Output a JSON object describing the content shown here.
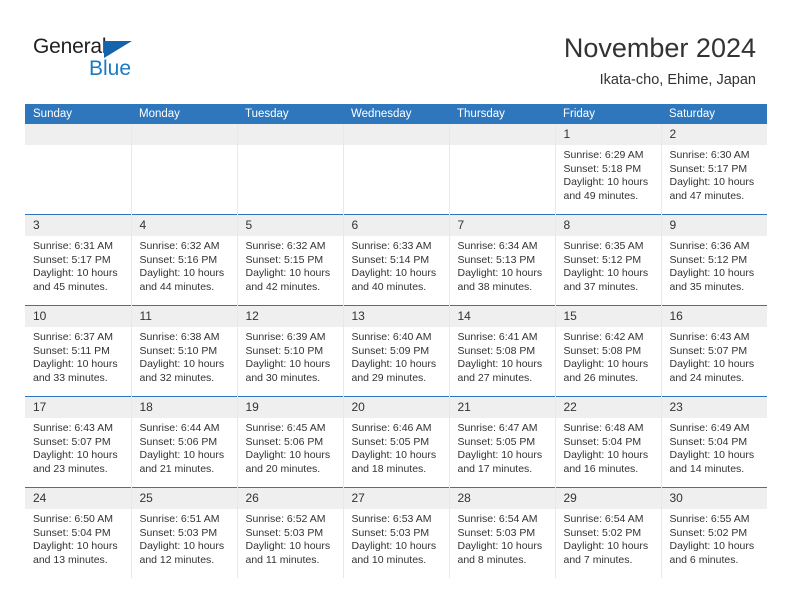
{
  "brand": {
    "name_part1": "General",
    "name_part2": "Blue",
    "triangle_icon": "blue-triangle-icon",
    "accent_color": "#1a7bc4"
  },
  "header": {
    "title": "November 2024",
    "subtitle": "Ikata-cho, Ehime, Japan",
    "header_bar_color": "#2f77bc",
    "daynum_band_color": "#efefef"
  },
  "weekdays": [
    "Sunday",
    "Monday",
    "Tuesday",
    "Wednesday",
    "Thursday",
    "Friday",
    "Saturday"
  ],
  "weeks": [
    [
      {
        "day": "",
        "sunrise": "",
        "sunset": "",
        "daylight_line1": "",
        "daylight_line2": ""
      },
      {
        "day": "",
        "sunrise": "",
        "sunset": "",
        "daylight_line1": "",
        "daylight_line2": ""
      },
      {
        "day": "",
        "sunrise": "",
        "sunset": "",
        "daylight_line1": "",
        "daylight_line2": ""
      },
      {
        "day": "",
        "sunrise": "",
        "sunset": "",
        "daylight_line1": "",
        "daylight_line2": ""
      },
      {
        "day": "",
        "sunrise": "",
        "sunset": "",
        "daylight_line1": "",
        "daylight_line2": ""
      },
      {
        "day": "1",
        "sunrise": "Sunrise: 6:29 AM",
        "sunset": "Sunset: 5:18 PM",
        "daylight_line1": "Daylight: 10 hours",
        "daylight_line2": "and 49 minutes."
      },
      {
        "day": "2",
        "sunrise": "Sunrise: 6:30 AM",
        "sunset": "Sunset: 5:17 PM",
        "daylight_line1": "Daylight: 10 hours",
        "daylight_line2": "and 47 minutes."
      }
    ],
    [
      {
        "day": "3",
        "sunrise": "Sunrise: 6:31 AM",
        "sunset": "Sunset: 5:17 PM",
        "daylight_line1": "Daylight: 10 hours",
        "daylight_line2": "and 45 minutes."
      },
      {
        "day": "4",
        "sunrise": "Sunrise: 6:32 AM",
        "sunset": "Sunset: 5:16 PM",
        "daylight_line1": "Daylight: 10 hours",
        "daylight_line2": "and 44 minutes."
      },
      {
        "day": "5",
        "sunrise": "Sunrise: 6:32 AM",
        "sunset": "Sunset: 5:15 PM",
        "daylight_line1": "Daylight: 10 hours",
        "daylight_line2": "and 42 minutes."
      },
      {
        "day": "6",
        "sunrise": "Sunrise: 6:33 AM",
        "sunset": "Sunset: 5:14 PM",
        "daylight_line1": "Daylight: 10 hours",
        "daylight_line2": "and 40 minutes."
      },
      {
        "day": "7",
        "sunrise": "Sunrise: 6:34 AM",
        "sunset": "Sunset: 5:13 PM",
        "daylight_line1": "Daylight: 10 hours",
        "daylight_line2": "and 38 minutes."
      },
      {
        "day": "8",
        "sunrise": "Sunrise: 6:35 AM",
        "sunset": "Sunset: 5:12 PM",
        "daylight_line1": "Daylight: 10 hours",
        "daylight_line2": "and 37 minutes."
      },
      {
        "day": "9",
        "sunrise": "Sunrise: 6:36 AM",
        "sunset": "Sunset: 5:12 PM",
        "daylight_line1": "Daylight: 10 hours",
        "daylight_line2": "and 35 minutes."
      }
    ],
    [
      {
        "day": "10",
        "sunrise": "Sunrise: 6:37 AM",
        "sunset": "Sunset: 5:11 PM",
        "daylight_line1": "Daylight: 10 hours",
        "daylight_line2": "and 33 minutes."
      },
      {
        "day": "11",
        "sunrise": "Sunrise: 6:38 AM",
        "sunset": "Sunset: 5:10 PM",
        "daylight_line1": "Daylight: 10 hours",
        "daylight_line2": "and 32 minutes."
      },
      {
        "day": "12",
        "sunrise": "Sunrise: 6:39 AM",
        "sunset": "Sunset: 5:10 PM",
        "daylight_line1": "Daylight: 10 hours",
        "daylight_line2": "and 30 minutes."
      },
      {
        "day": "13",
        "sunrise": "Sunrise: 6:40 AM",
        "sunset": "Sunset: 5:09 PM",
        "daylight_line1": "Daylight: 10 hours",
        "daylight_line2": "and 29 minutes."
      },
      {
        "day": "14",
        "sunrise": "Sunrise: 6:41 AM",
        "sunset": "Sunset: 5:08 PM",
        "daylight_line1": "Daylight: 10 hours",
        "daylight_line2": "and 27 minutes."
      },
      {
        "day": "15",
        "sunrise": "Sunrise: 6:42 AM",
        "sunset": "Sunset: 5:08 PM",
        "daylight_line1": "Daylight: 10 hours",
        "daylight_line2": "and 26 minutes."
      },
      {
        "day": "16",
        "sunrise": "Sunrise: 6:43 AM",
        "sunset": "Sunset: 5:07 PM",
        "daylight_line1": "Daylight: 10 hours",
        "daylight_line2": "and 24 minutes."
      }
    ],
    [
      {
        "day": "17",
        "sunrise": "Sunrise: 6:43 AM",
        "sunset": "Sunset: 5:07 PM",
        "daylight_line1": "Daylight: 10 hours",
        "daylight_line2": "and 23 minutes."
      },
      {
        "day": "18",
        "sunrise": "Sunrise: 6:44 AM",
        "sunset": "Sunset: 5:06 PM",
        "daylight_line1": "Daylight: 10 hours",
        "daylight_line2": "and 21 minutes."
      },
      {
        "day": "19",
        "sunrise": "Sunrise: 6:45 AM",
        "sunset": "Sunset: 5:06 PM",
        "daylight_line1": "Daylight: 10 hours",
        "daylight_line2": "and 20 minutes."
      },
      {
        "day": "20",
        "sunrise": "Sunrise: 6:46 AM",
        "sunset": "Sunset: 5:05 PM",
        "daylight_line1": "Daylight: 10 hours",
        "daylight_line2": "and 18 minutes."
      },
      {
        "day": "21",
        "sunrise": "Sunrise: 6:47 AM",
        "sunset": "Sunset: 5:05 PM",
        "daylight_line1": "Daylight: 10 hours",
        "daylight_line2": "and 17 minutes."
      },
      {
        "day": "22",
        "sunrise": "Sunrise: 6:48 AM",
        "sunset": "Sunset: 5:04 PM",
        "daylight_line1": "Daylight: 10 hours",
        "daylight_line2": "and 16 minutes."
      },
      {
        "day": "23",
        "sunrise": "Sunrise: 6:49 AM",
        "sunset": "Sunset: 5:04 PM",
        "daylight_line1": "Daylight: 10 hours",
        "daylight_line2": "and 14 minutes."
      }
    ],
    [
      {
        "day": "24",
        "sunrise": "Sunrise: 6:50 AM",
        "sunset": "Sunset: 5:04 PM",
        "daylight_line1": "Daylight: 10 hours",
        "daylight_line2": "and 13 minutes."
      },
      {
        "day": "25",
        "sunrise": "Sunrise: 6:51 AM",
        "sunset": "Sunset: 5:03 PM",
        "daylight_line1": "Daylight: 10 hours",
        "daylight_line2": "and 12 minutes."
      },
      {
        "day": "26",
        "sunrise": "Sunrise: 6:52 AM",
        "sunset": "Sunset: 5:03 PM",
        "daylight_line1": "Daylight: 10 hours",
        "daylight_line2": "and 11 minutes."
      },
      {
        "day": "27",
        "sunrise": "Sunrise: 6:53 AM",
        "sunset": "Sunset: 5:03 PM",
        "daylight_line1": "Daylight: 10 hours",
        "daylight_line2": "and 10 minutes."
      },
      {
        "day": "28",
        "sunrise": "Sunrise: 6:54 AM",
        "sunset": "Sunset: 5:03 PM",
        "daylight_line1": "Daylight: 10 hours",
        "daylight_line2": "and 8 minutes."
      },
      {
        "day": "29",
        "sunrise": "Sunrise: 6:54 AM",
        "sunset": "Sunset: 5:02 PM",
        "daylight_line1": "Daylight: 10 hours",
        "daylight_line2": "and 7 minutes."
      },
      {
        "day": "30",
        "sunrise": "Sunrise: 6:55 AM",
        "sunset": "Sunset: 5:02 PM",
        "daylight_line1": "Daylight: 10 hours",
        "daylight_line2": "and 6 minutes."
      }
    ]
  ]
}
